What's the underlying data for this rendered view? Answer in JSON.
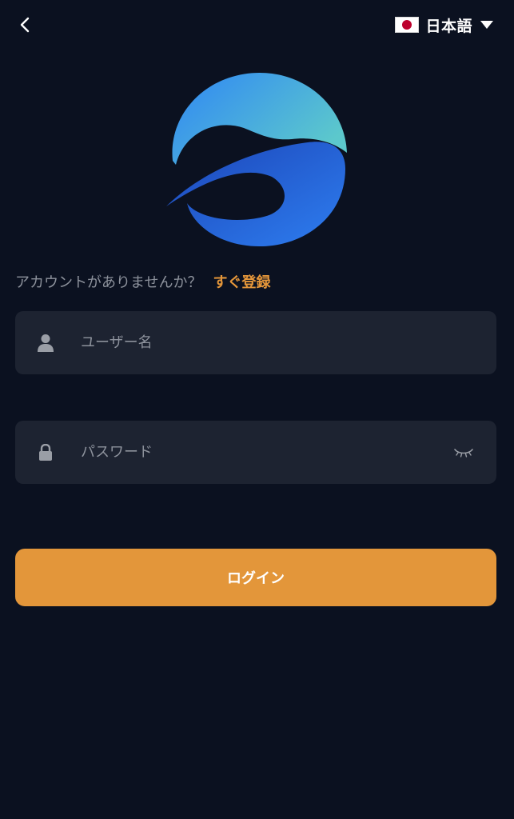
{
  "header": {
    "back_icon": "chevron-left-icon",
    "language": {
      "flag_icon": "japan-flag-icon",
      "label": "日本語",
      "caret_icon": "triangle-down-icon"
    }
  },
  "logo": {
    "icon": "brand-logo",
    "colors": [
      "#4fc3c9",
      "#2f86f5",
      "#1d4fc4"
    ]
  },
  "signup": {
    "question": "アカウントがありませんか？",
    "link_label": "すぐ登録"
  },
  "form": {
    "username": {
      "icon": "user-icon",
      "placeholder": "ユーザー名",
      "value": ""
    },
    "password": {
      "icon": "lock-icon",
      "placeholder": "パスワード",
      "value": "",
      "toggle_icon": "eye-closed-icon"
    },
    "login_label": "ログイン"
  },
  "colors": {
    "background": "#0b1120",
    "field_bg": "#1d2331",
    "accent": "#e3963a",
    "muted_text": "#8d929c"
  }
}
